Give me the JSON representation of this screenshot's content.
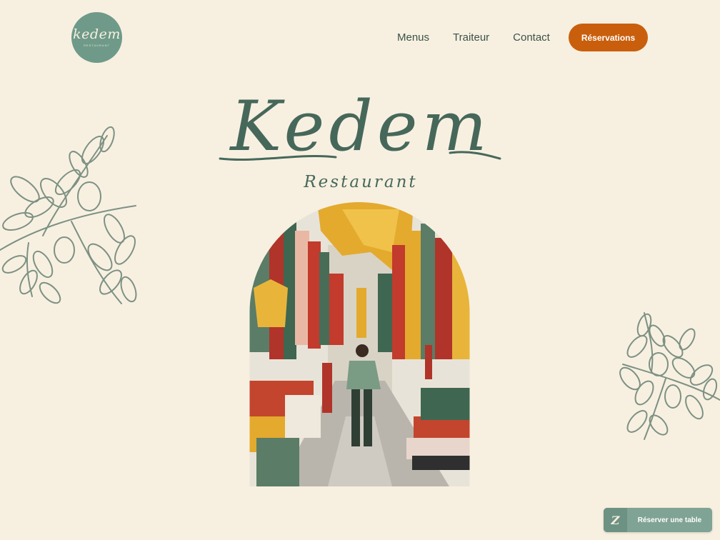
{
  "brand": {
    "logo_text": "kedem",
    "logo_subtext": "RESTAURANT",
    "hero_title": "Kedem",
    "hero_subtitle": "Restaurant",
    "primary_color": "#46685a",
    "accent_color": "#c95f0c",
    "background_color": "#f7f0e1"
  },
  "nav": {
    "items": [
      {
        "label": "Menus"
      },
      {
        "label": "Traiteur"
      },
      {
        "label": "Contact"
      }
    ],
    "cta_label": "Réservations"
  },
  "widget": {
    "icon": "z-icon",
    "icon_glyph": "Z",
    "label": "Réserver une table"
  },
  "hero_image": {
    "icon": "market-street-illustration"
  }
}
